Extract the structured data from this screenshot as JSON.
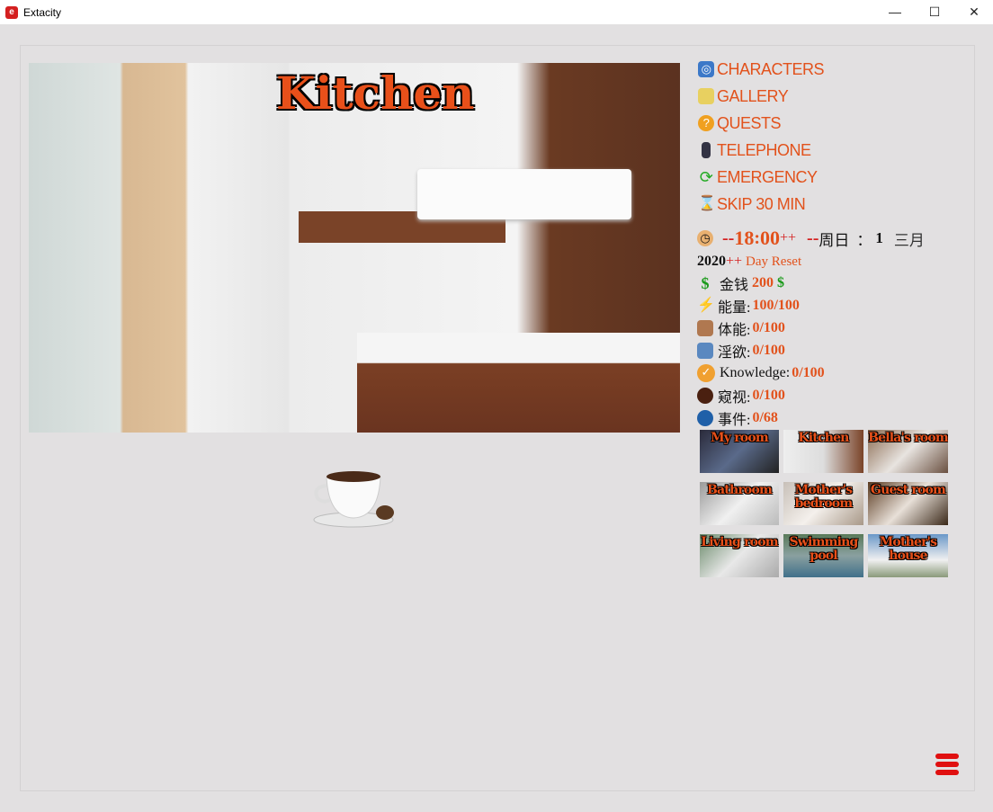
{
  "window": {
    "title": "Extacity",
    "minimize": "—",
    "maximize": "☐",
    "close": "✕"
  },
  "scene": {
    "title": "Kitchen"
  },
  "menu": [
    {
      "label": "CHARACTERS",
      "icon": "characters-icon"
    },
    {
      "label": "GALLERY",
      "icon": "gallery-icon"
    },
    {
      "label": "QUESTS",
      "icon": "quests-icon"
    },
    {
      "label": "TELEPHONE",
      "icon": "telephone-icon"
    },
    {
      "label": "EMERGENCY",
      "icon": "emergency-icon"
    },
    {
      "label": "SKIP 30 MIN",
      "icon": "hourglass-icon"
    }
  ],
  "time": {
    "prefix": "--",
    "hour": "18",
    "sep": ":",
    "minute": "00",
    "plus": "++",
    "day_prefix": "--",
    "weekday": "周日",
    "colon": "：",
    "day": "1",
    "month": "三月",
    "year": "2020",
    "year_plus": "++",
    "day_reset": "Day Reset"
  },
  "stats": {
    "money_label": "金钱",
    "money_value": "200",
    "money_unit": "$",
    "energy_label": "能量:",
    "energy_value": "100/100",
    "stamina_label": "体能:",
    "stamina_value": "0/100",
    "lust_label": "淫欲:",
    "lust_value": "0/100",
    "knowledge_label": "Knowledge:",
    "knowledge_value": "0/100",
    "peek_label": "窥视:",
    "peek_value": "0/100",
    "events_label": "事件:",
    "events_value": "0/68"
  },
  "rooms": [
    {
      "label": "My room"
    },
    {
      "label": "Kitchen"
    },
    {
      "label": "Bella's room"
    },
    {
      "label": "Bathroom"
    },
    {
      "label": "Mother's bedroom"
    },
    {
      "label": "Guest room"
    },
    {
      "label": "Living room"
    },
    {
      "label": "Swimming pool"
    },
    {
      "label": "Mother's house"
    }
  ],
  "colors": {
    "accent": "#e2521c",
    "red": "#d42020",
    "money": "#1a9a1a"
  }
}
